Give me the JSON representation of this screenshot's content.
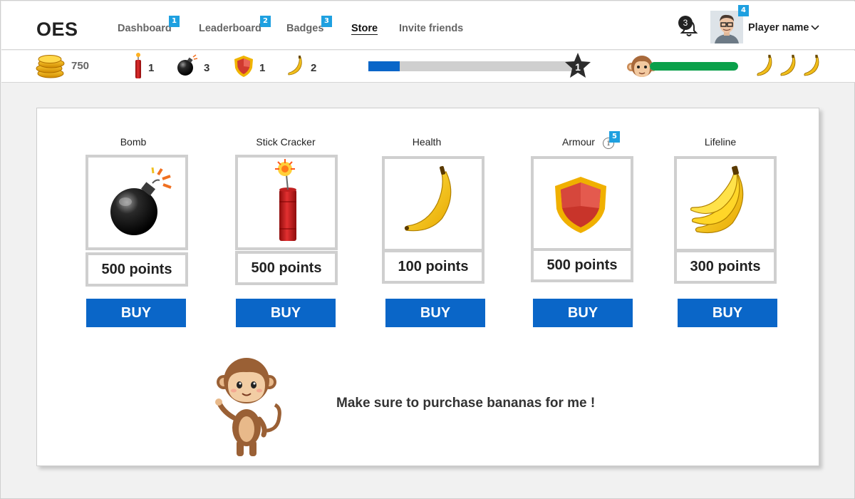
{
  "app": {
    "logo": "OES"
  },
  "nav": {
    "items": [
      {
        "label": "Dashboard",
        "badge": "1"
      },
      {
        "label": "Leaderboard",
        "badge": "2"
      },
      {
        "label": "Badges",
        "badge": "3"
      },
      {
        "label": "Store",
        "active": true
      },
      {
        "label": "Invite friends"
      }
    ]
  },
  "notifications": {
    "count": "3"
  },
  "user": {
    "name": "Player name",
    "badge": "4"
  },
  "status": {
    "coins": "750",
    "stick_crackers": "1",
    "bombs": "3",
    "armour": "1",
    "bananas": "2",
    "level": "1",
    "xp_progress": 0.15,
    "health_progress": 1.0,
    "lifeline_icons": [
      "banana-icon",
      "banana-icon",
      "banana-icon"
    ]
  },
  "store": {
    "items": [
      {
        "title": "Bomb",
        "price": "500 points",
        "buy": "BUY",
        "icon": "bomb-icon"
      },
      {
        "title": "Stick Cracker",
        "price": "500 points",
        "buy": "BUY",
        "icon": "stick-cracker-icon"
      },
      {
        "title": "Health",
        "price": "100 points",
        "buy": "BUY",
        "icon": "banana-icon"
      },
      {
        "title": "Armour",
        "price": "500 points",
        "buy": "BUY",
        "icon": "shield-icon",
        "info": "i",
        "badge": "5"
      },
      {
        "title": "Lifeline",
        "price": "300 points",
        "buy": "BUY",
        "icon": "banana-bunch-icon"
      }
    ],
    "mascot_message": "Make sure to purchase bananas for me !"
  },
  "colors": {
    "primary": "#0a66c8",
    "badge": "#1ea0e0",
    "health": "#0aa04a",
    "xp_track": "#cfcfcf"
  }
}
